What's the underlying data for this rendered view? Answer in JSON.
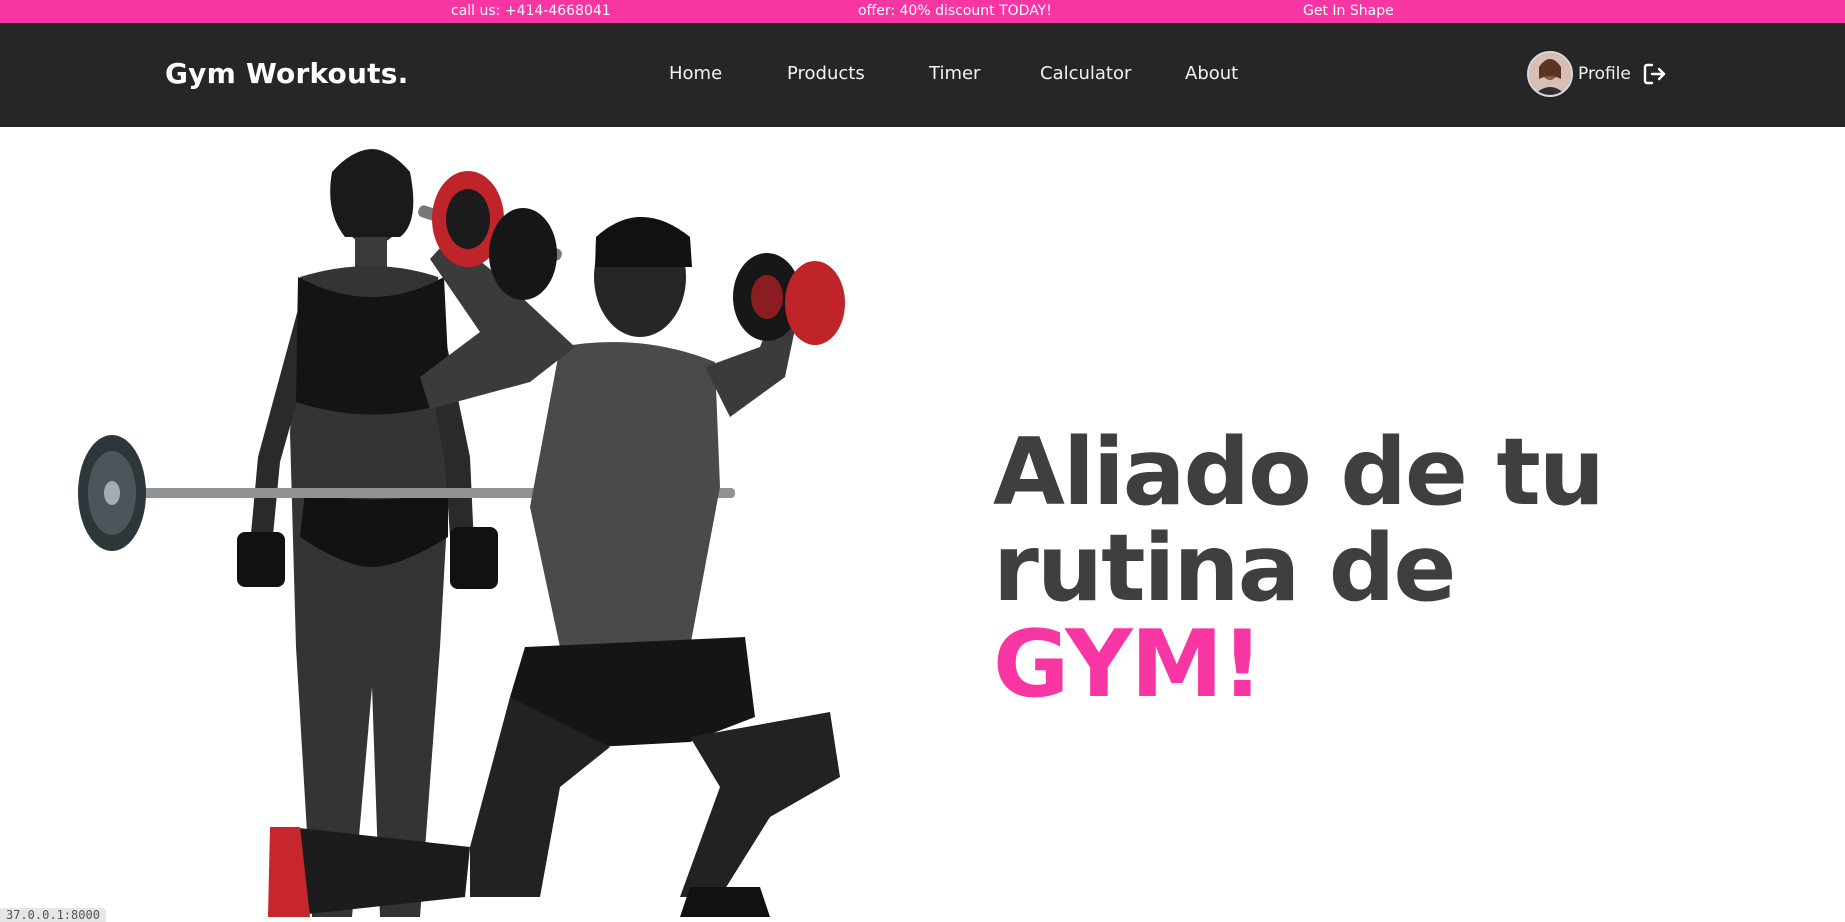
{
  "topbar": {
    "phone": "call us: +414-4668041",
    "offer": "offer: 40% discount TODAY!",
    "tagline": "Get In Shape",
    "color": "#f735a3"
  },
  "navbar": {
    "logo": "Gym Workouts.",
    "items": [
      "Home",
      "Products",
      "Timer",
      "Calculator",
      "About"
    ],
    "profile_label": "Profile",
    "background": "#262626",
    "icons": {
      "avatar": "user-avatar",
      "logout": "logout-icon"
    }
  },
  "hero": {
    "title_line1": "Aliado de tu",
    "title_line2": "rutina de",
    "title_accent": "GYM!",
    "accent_color": "#f735a3",
    "image": "gym-athletes-silhouette"
  },
  "status": "37.0.0.1:8000"
}
